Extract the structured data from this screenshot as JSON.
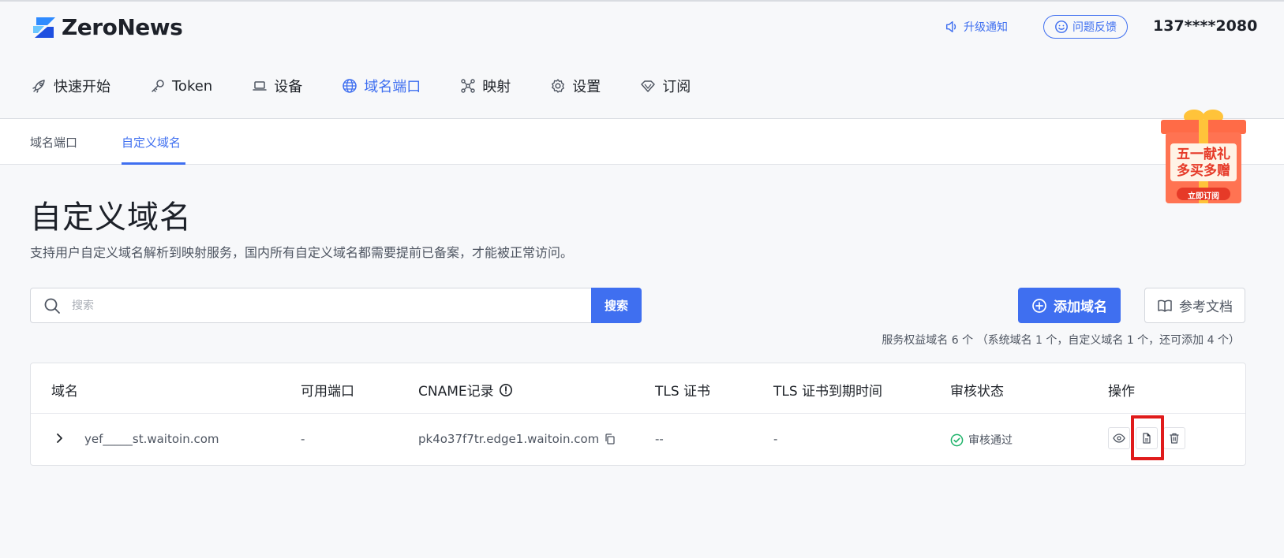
{
  "header": {
    "logo_text": "ZeroNews",
    "notice_label": "升级通知",
    "feedback_label": "问题反馈",
    "user_phone": "137****2080"
  },
  "nav": {
    "items": [
      {
        "label": "快速开始",
        "icon": "rocket-icon"
      },
      {
        "label": "Token",
        "icon": "key-icon"
      },
      {
        "label": "设备",
        "icon": "laptop-icon"
      },
      {
        "label": "域名端口",
        "icon": "globe-icon",
        "active": true
      },
      {
        "label": "映射",
        "icon": "network-icon"
      },
      {
        "label": "设置",
        "icon": "gear-icon"
      },
      {
        "label": "订阅",
        "icon": "diamond-icon"
      }
    ]
  },
  "subnav": {
    "tabs": [
      {
        "label": "域名端口"
      },
      {
        "label": "自定义域名",
        "active": true
      }
    ]
  },
  "promo": {
    "line1": "五一献礼",
    "line2": "多买多赠",
    "button": "立即订阅"
  },
  "page": {
    "title": "自定义域名",
    "description": "支持用户自定义域名解析到映射服务，国内所有自定义域名都需要提前已备案，才能被正常访问。"
  },
  "search": {
    "placeholder": "搜索",
    "button_label": "搜索"
  },
  "actions": {
    "add_label": "添加域名",
    "docs_label": "参考文档"
  },
  "quota_text": "服务权益域名 6 个 （系统域名 1 个，自定义域名 1 个，还可添加 4 个）",
  "table": {
    "columns": [
      "域名",
      "可用端口",
      "CNAME记录",
      "TLS 证书",
      "TLS 证书到期时间",
      "审核状态",
      "操作"
    ],
    "rows": [
      {
        "domain": "yef_____st.waitoin.com",
        "port": "-",
        "cname": "pk4o37f7tr.edge1.waitoin.com",
        "tls": "--",
        "tls_expiry": "-",
        "status": "审核通过"
      }
    ]
  },
  "colors": {
    "accent": "#3f6ff0",
    "success": "#1fb36a",
    "highlight": "#e01b1b"
  }
}
